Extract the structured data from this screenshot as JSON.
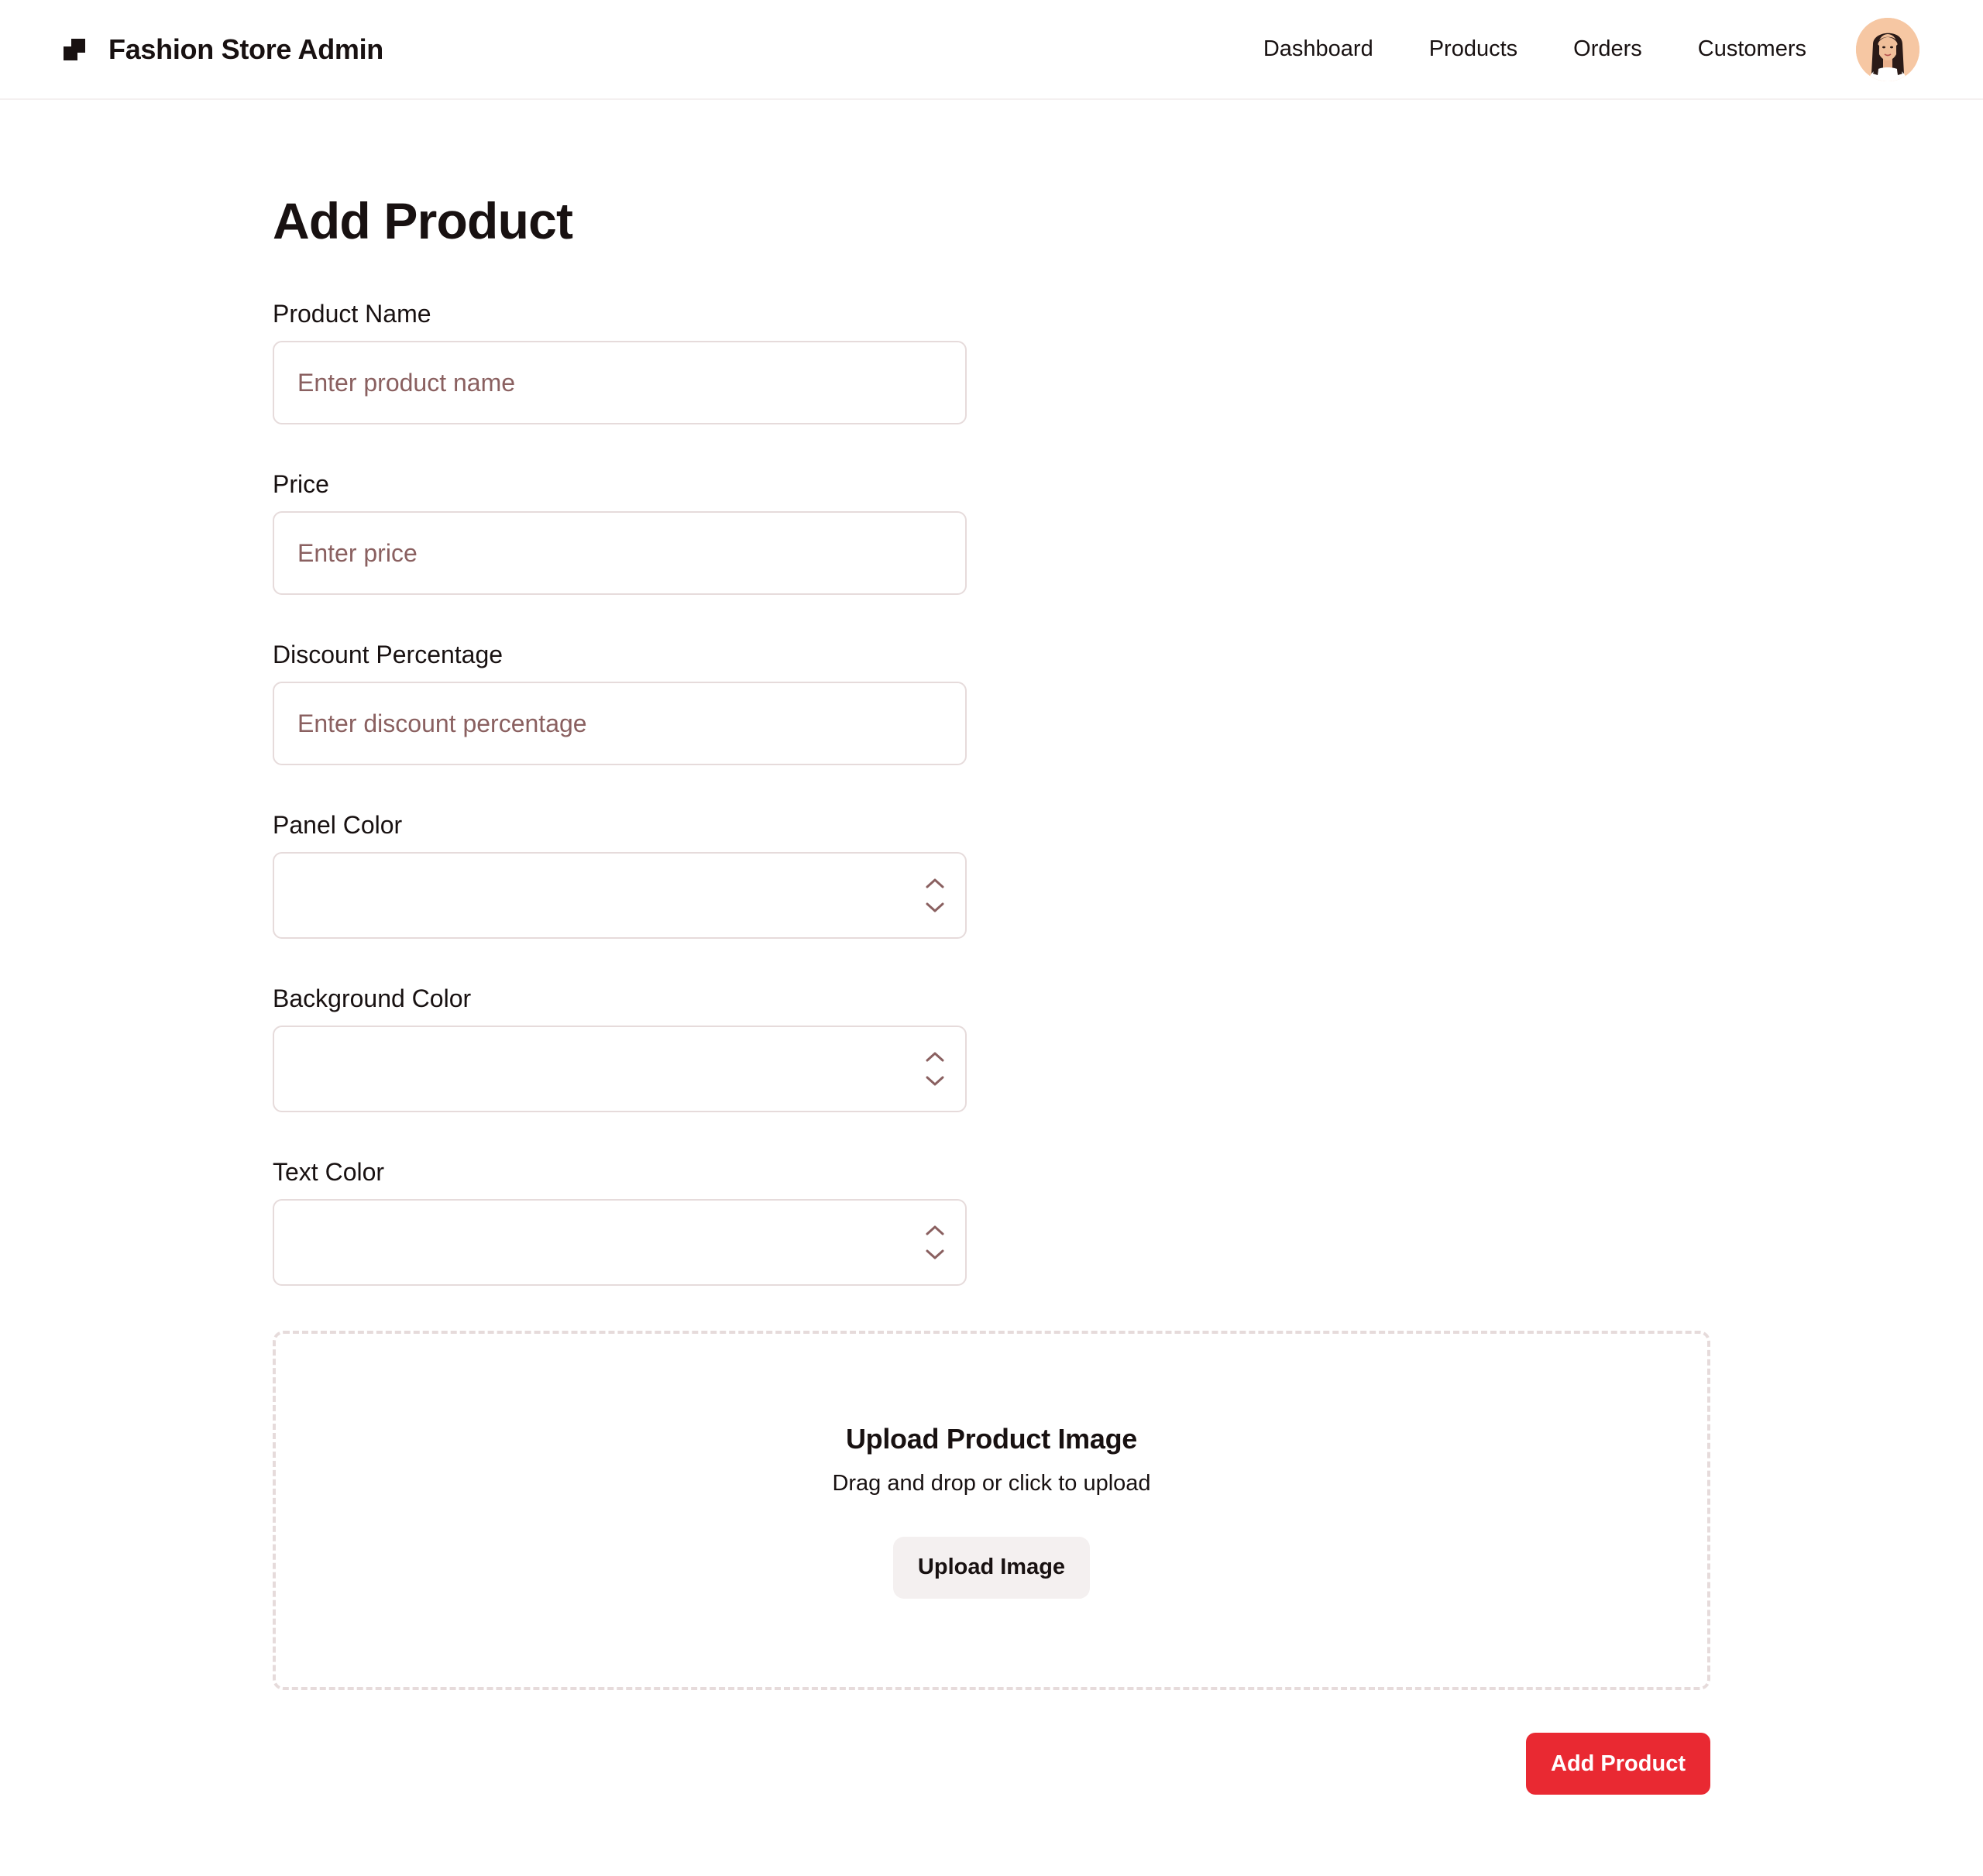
{
  "header": {
    "brand_title": "Fashion Store Admin",
    "logo_icon": "store-logo-icon",
    "nav": [
      {
        "label": "Dashboard"
      },
      {
        "label": "Products"
      },
      {
        "label": "Orders"
      },
      {
        "label": "Customers"
      }
    ],
    "avatar_icon": "user-avatar"
  },
  "form": {
    "title": "Add Product",
    "product_name": {
      "label": "Product Name",
      "placeholder": "Enter product name",
      "value": ""
    },
    "price": {
      "label": "Price",
      "placeholder": "Enter price",
      "value": ""
    },
    "discount": {
      "label": "Discount Percentage",
      "placeholder": "Enter discount percentage",
      "value": ""
    },
    "panel_color": {
      "label": "Panel Color",
      "value": ""
    },
    "background_color": {
      "label": "Background Color",
      "value": ""
    },
    "text_color": {
      "label": "Text Color",
      "value": ""
    },
    "upload": {
      "title": "Upload Product Image",
      "subtitle": "Drag and drop or click to upload",
      "button_label": "Upload Image"
    },
    "submit_label": "Add Product"
  },
  "colors": {
    "accent": "#e92932",
    "text": "#181111",
    "placeholder": "#8a6060",
    "border": "#e6dbdb",
    "muted_bg": "#f4f0f0"
  }
}
